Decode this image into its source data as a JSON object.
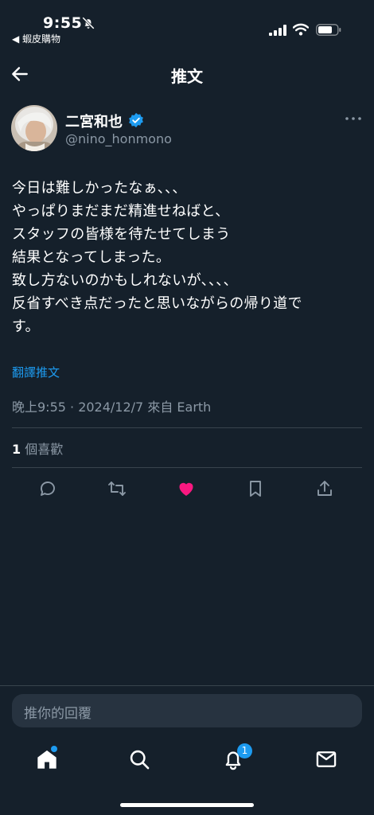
{
  "status_bar": {
    "time": "9:55",
    "back_app": "◀ 蝦皮購物"
  },
  "header": {
    "title": "推文"
  },
  "tweet": {
    "author": {
      "name": "二宮和也",
      "handle": "@nino_honmono",
      "verified": true
    },
    "lines": [
      "今日は難しかったなぁ、、、",
      "やっぱりまだまだ精進せねばと、",
      "スタッフの皆様を待たせてしまう",
      "結果となってしまった。",
      "致し方ないのかもしれないが、、、、",
      "反省すべき点だったと思いながらの帰り道で",
      "す。"
    ],
    "translate_label": "翻譯推文",
    "meta": "晚上9:55 · 2024/12/7 來自 Earth",
    "likes_count": "1",
    "likes_label": " 個喜歡"
  },
  "actions": [
    {
      "icon": "reply-icon"
    },
    {
      "icon": "retweet-icon"
    },
    {
      "icon": "like-icon",
      "active": true,
      "color": "#f91880"
    },
    {
      "icon": "bookmark-icon"
    },
    {
      "icon": "share-icon"
    }
  ],
  "reply": {
    "placeholder": "推你的回覆"
  },
  "bottom_nav": {
    "items": [
      "home-icon",
      "search-icon",
      "notifications-icon",
      "messages-icon"
    ],
    "notification_badge": "1"
  },
  "colors": {
    "background": "#15202b",
    "accent": "#1d9bf0",
    "like": "#f91880",
    "secondary_text": "#8b98a5"
  }
}
